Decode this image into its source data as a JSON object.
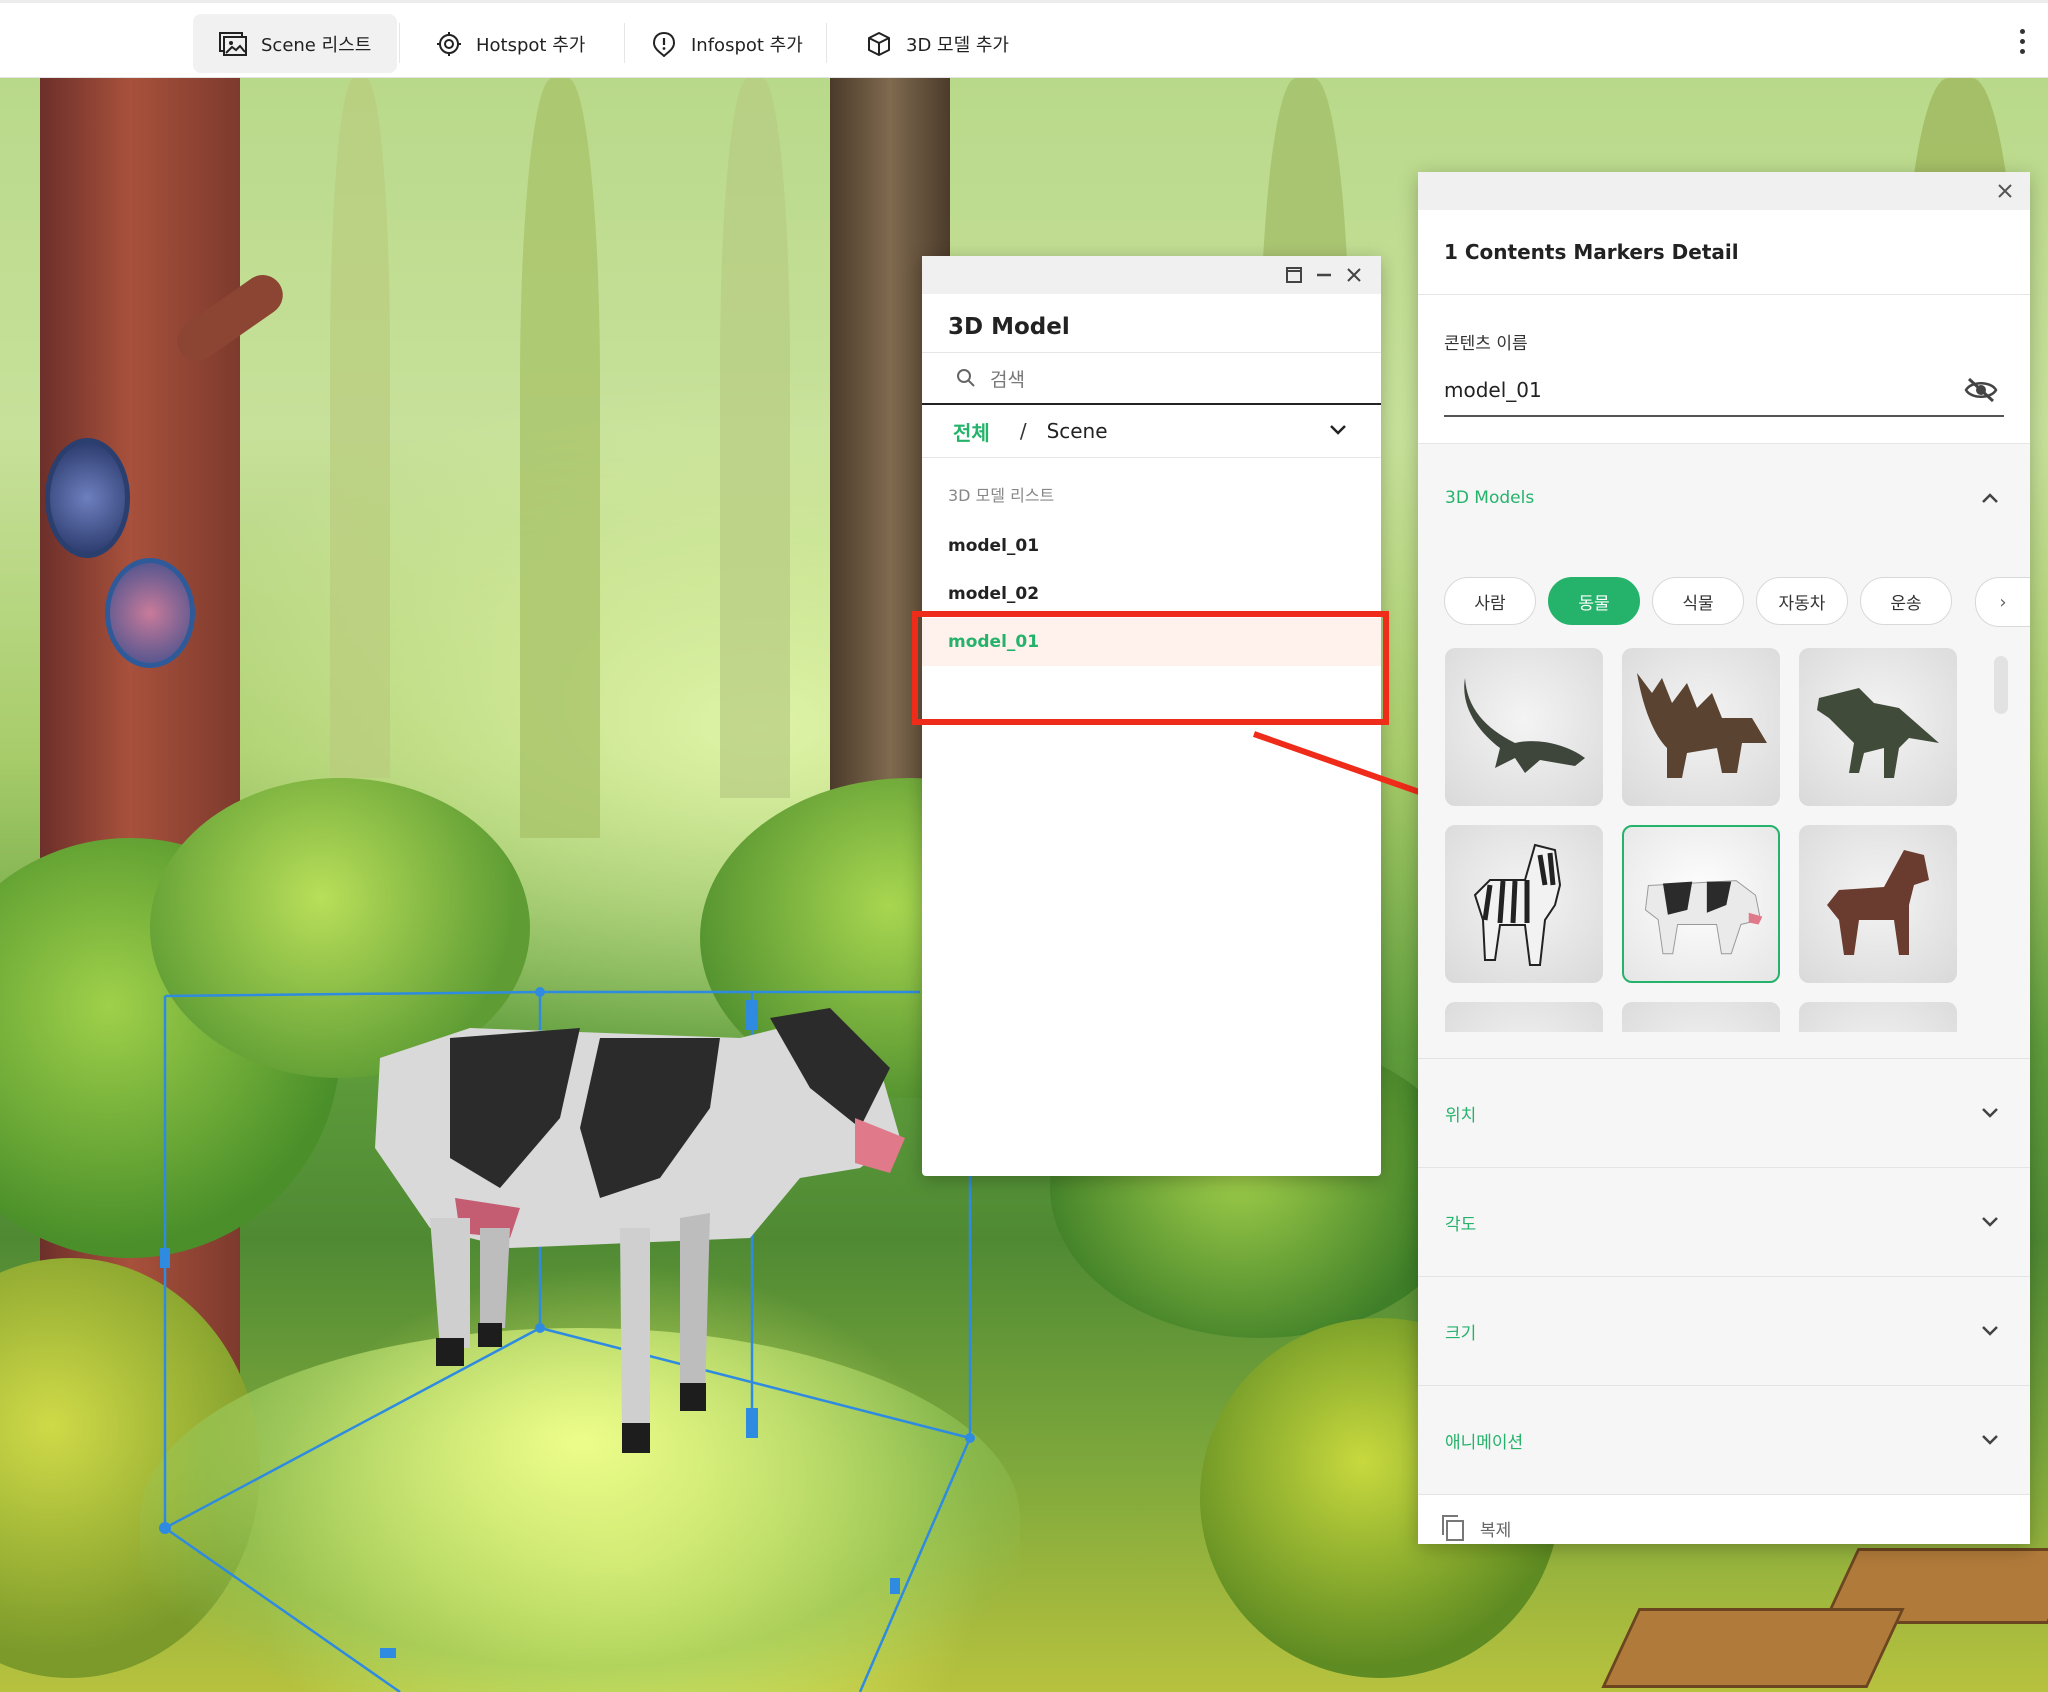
{
  "toolbar": {
    "items": [
      {
        "label": "Scene 리스트",
        "icon": "scene-list-icon"
      },
      {
        "label": "Hotspot 추가",
        "icon": "hotspot-icon"
      },
      {
        "label": "Infospot 추가",
        "icon": "infospot-icon"
      },
      {
        "label": "3D 모델 추가",
        "icon": "cube-icon"
      }
    ],
    "more_icon": "kebab-menu-icon"
  },
  "model_panel": {
    "title": "3D Model",
    "search_placeholder": "검색",
    "filter": {
      "all": "전체",
      "separator": "/",
      "scene": "Scene"
    },
    "list_title": "3D 모델 리스트",
    "items": [
      "model_01",
      "model_02",
      "model_01"
    ],
    "selected_index": 2
  },
  "detail": {
    "title": "1 Contents Markers Detail",
    "name_label": "콘텐츠 이름",
    "name_value": "model_01",
    "models_section": "3D Models",
    "categories": [
      "사람",
      "동물",
      "식물",
      "자동차",
      "운송"
    ],
    "active_category": "동물",
    "thumbnails": [
      "dinosaur-long-neck",
      "stegosaurus",
      "t-rex",
      "zebra",
      "cow",
      "horse"
    ],
    "selected_thumbnail": "cow",
    "sections": [
      "위치",
      "각도",
      "크기",
      "애니메이션"
    ],
    "copy_label": "복제"
  },
  "colors": {
    "accent": "#25b36b",
    "annotation": "#ef2b1a",
    "selected_row": "#fff1ec",
    "gizmo": "#2f8be0"
  }
}
